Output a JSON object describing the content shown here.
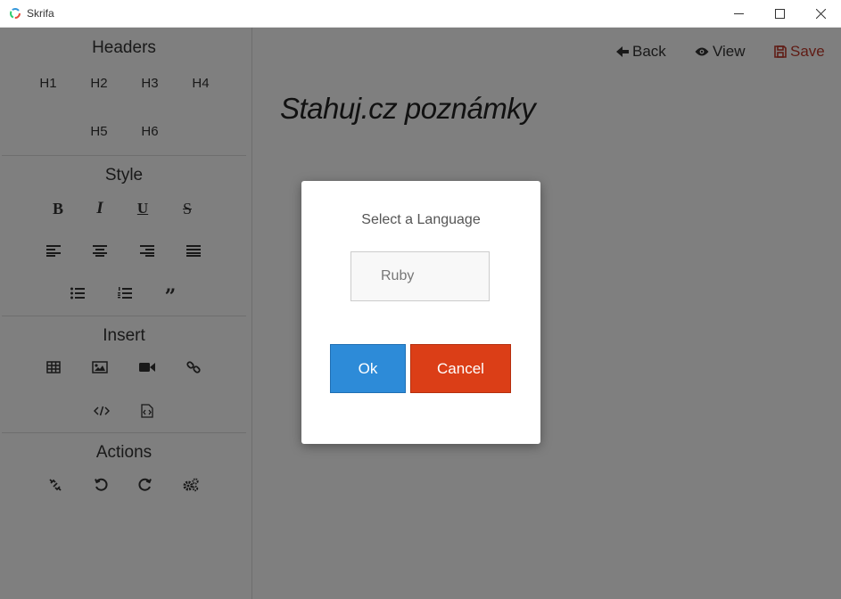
{
  "window": {
    "title": "Skrifa",
    "minimize_icon": "minimize-icon",
    "maximize_icon": "maximize-icon",
    "close_icon": "close-icon"
  },
  "sidebar": {
    "headers": {
      "title": "Headers",
      "items": [
        "H1",
        "H2",
        "H3",
        "H4",
        "H5",
        "H6"
      ]
    },
    "style": {
      "title": "Style",
      "tools": [
        "bold-icon",
        "italic-icon",
        "underline-icon",
        "strikethrough-icon",
        "align-left-icon",
        "align-center-icon",
        "align-right-icon",
        "align-justify-icon",
        "bullet-list-icon",
        "numbered-list-icon",
        "quote-icon"
      ]
    },
    "insert": {
      "title": "Insert",
      "tools": [
        "table-icon",
        "image-icon",
        "video-icon",
        "link-icon",
        "code-icon",
        "code-file-icon"
      ]
    },
    "actions": {
      "title": "Actions",
      "tools": [
        "unlink-icon",
        "undo-icon",
        "redo-icon",
        "settings-icon"
      ]
    }
  },
  "toolbar": {
    "back": "Back",
    "view": "View",
    "save": "Save",
    "save_color": "#c0392b"
  },
  "document": {
    "title": "Stahuj.cz poznámky"
  },
  "dialog": {
    "title": "Select a Language",
    "language_value": "Ruby",
    "ok_label": "Ok",
    "cancel_label": "Cancel",
    "ok_color": "#2d8bd8",
    "cancel_color": "#db3e17"
  }
}
